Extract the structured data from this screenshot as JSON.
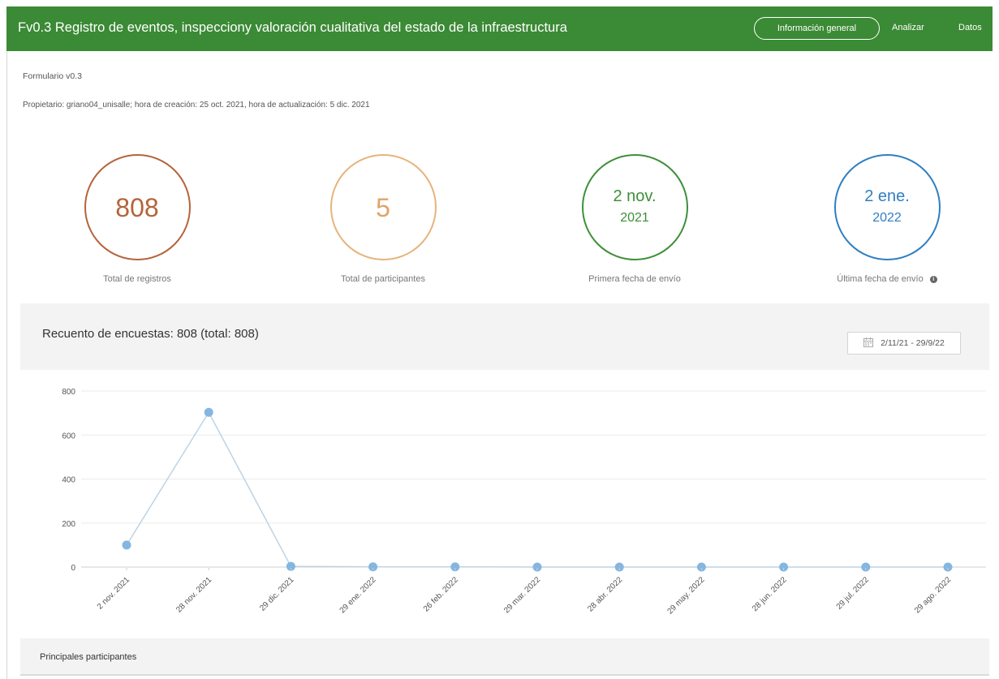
{
  "header": {
    "title": "Fv0.3 Registro de eventos, inspecciony valoración cualitativa del estado de la infraestructura",
    "nav": {
      "general": "Información general",
      "analyze": "Analizar",
      "data": "Datos"
    },
    "color": "#3b8a35"
  },
  "meta": {
    "form": "Formulario v0.3",
    "owner": "Propietario: griano04_unisalle; hora de creación: 25 oct. 2021, hora de actualización: 5 dic. 2021"
  },
  "kpis": {
    "records": {
      "value": "808",
      "label": "Total de registros",
      "color": "#b4643b"
    },
    "participants": {
      "value": "5",
      "label": "Total de participantes",
      "color": "#e6b47d"
    },
    "first": {
      "line1": "2 nov.",
      "line2": "2021",
      "label": "Primera fecha de envío",
      "color": "#3e8f3a"
    },
    "last": {
      "line1": "2 ene.",
      "line2": "2022",
      "label": "Última fecha de envío",
      "color": "#2f7fc1"
    }
  },
  "chart_section": {
    "title": "Recuento de encuestas: 808 (total: 808)",
    "date_range": "2/11/21 - 29/9/22",
    "icon": "calendar-icon"
  },
  "chart_data": {
    "type": "line",
    "categories": [
      "2 nov. 2021",
      "28 nov. 2021",
      "29 dic. 2021",
      "29 ene. 2022",
      "26 feb. 2022",
      "29 mar. 2022",
      "28 abr. 2022",
      "29 may. 2022",
      "28 jun. 2022",
      "29 jul. 2022",
      "29 ago. 2022"
    ],
    "values": [
      100,
      703,
      3,
      1,
      1,
      0,
      0,
      0,
      0,
      0,
      0
    ],
    "yticks": [
      "800",
      "600",
      "400",
      "200",
      "0"
    ],
    "ylim": [
      0,
      800
    ],
    "grid": true,
    "line_color": "#bdd3e4",
    "marker_color": "#84b6e0"
  },
  "bottom": {
    "title": "Principales participantes"
  }
}
